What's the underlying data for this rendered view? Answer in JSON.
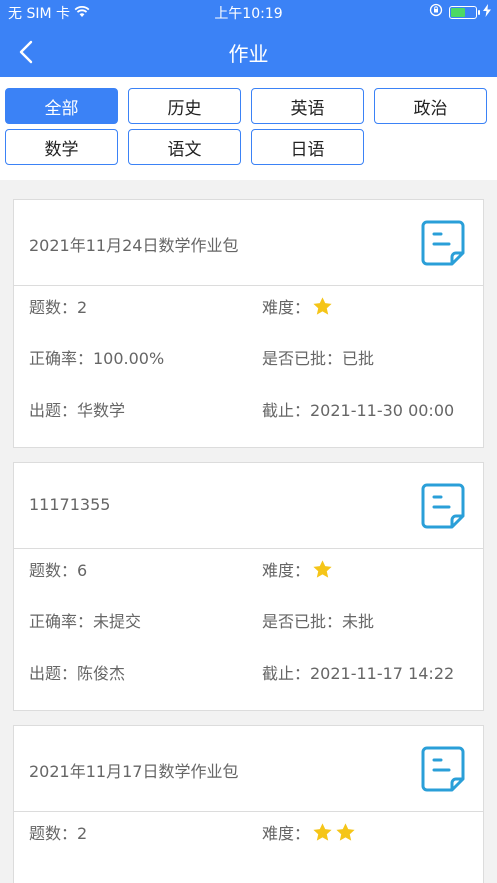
{
  "status_bar": {
    "carrier": "无 SIM 卡",
    "time": "上午10:19",
    "battery_level": 0.6
  },
  "nav": {
    "title": "作业"
  },
  "tabs": [
    {
      "label": "全部",
      "active": true
    },
    {
      "label": "历史",
      "active": false
    },
    {
      "label": "英语",
      "active": false
    },
    {
      "label": "政治",
      "active": false
    },
    {
      "label": "数学",
      "active": false
    },
    {
      "label": "语文",
      "active": false
    },
    {
      "label": "日语",
      "active": false
    }
  ],
  "assignments": [
    {
      "title": "2021年11月24日数学作业包",
      "count": "题数：2",
      "difficulty_label": "难度：",
      "difficulty_stars": 1,
      "accuracy": "正确率：100.00%",
      "reviewed": "是否已批：已批",
      "author": "出题：华数学",
      "deadline": "截止：2021-11-30 00:00"
    },
    {
      "title": "11171355",
      "count": "题数：6",
      "difficulty_label": "难度：",
      "difficulty_stars": 1,
      "accuracy": "正确率：未提交",
      "reviewed": "是否已批：未批",
      "author": "出题：陈俊杰",
      "deadline": "截止：2021-11-17 14:22"
    },
    {
      "title": "2021年11月17日数学作业包",
      "count": "题数：2",
      "difficulty_label": "难度：",
      "difficulty_stars": 2
    }
  ],
  "colors": {
    "primary": "#3b82f6",
    "star": "#f5c518",
    "icon": "#2a9fd8"
  }
}
